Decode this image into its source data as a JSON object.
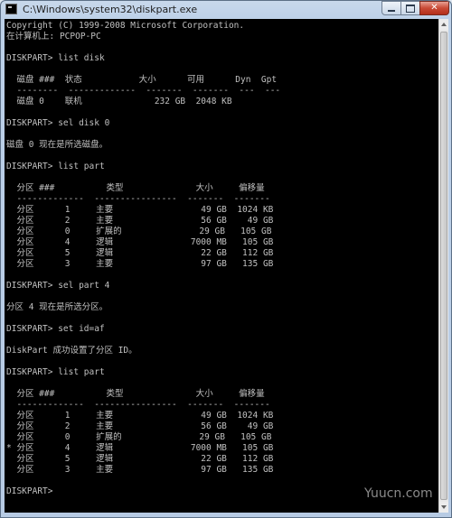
{
  "window": {
    "title": "C:\\Windows\\system32\\diskpart.exe",
    "icon": "console-icon"
  },
  "console": {
    "lines": [
      "Copyright (C) 1999-2008 Microsoft Corporation.",
      "在计算机上: PCPOP-PC",
      "",
      "DISKPART> list disk",
      "",
      "  磁盘 ###  状态           大小      可用      Dyn  Gpt",
      "  --------  -------------  -------  -------  ---  ---",
      "  磁盘 0    联机              232 GB  2048 KB",
      "",
      "DISKPART> sel disk 0",
      "",
      "磁盘 0 现在是所选磁盘。",
      "",
      "DISKPART> list part",
      "",
      "  分区 ###          类型              大小     偏移量",
      "  -------------  ----------------  -------  -------",
      "  分区      1     主要                 49 GB  1024 KB",
      "  分区      2     主要                 56 GB    49 GB",
      "  分区      0     扩展的               29 GB   105 GB",
      "  分区      4     逻辑               7000 MB   105 GB",
      "  分区      5     逻辑                 22 GB   112 GB",
      "  分区      3     主要                 97 GB   135 GB",
      "",
      "DISKPART> sel part 4",
      "",
      "分区 4 现在是所选分区。",
      "",
      "DISKPART> set id=af",
      "",
      "DiskPart 成功设置了分区 ID。",
      "",
      "DISKPART> list part",
      "",
      "  分区 ###          类型              大小     偏移量",
      "  -------------  ----------------  -------  -------",
      "  分区      1     主要                 49 GB  1024 KB",
      "  分区      2     主要                 56 GB    49 GB",
      "  分区      0     扩展的               29 GB   105 GB",
      "* 分区      4     逻辑               7000 MB   105 GB",
      "  分区      5     逻辑                 22 GB   112 GB",
      "  分区      3     主要                 97 GB   135 GB",
      "",
      "DISKPART>"
    ]
  },
  "watermark": "Yuucn.com"
}
